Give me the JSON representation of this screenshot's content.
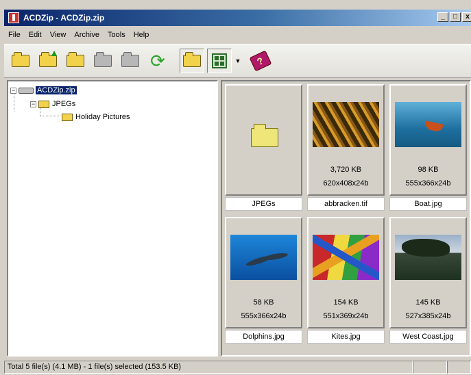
{
  "window": {
    "title": "ACDZip - ACDZip.zip"
  },
  "window_controls": {
    "minimize": "_",
    "maximize": "□",
    "close": "x"
  },
  "menu": [
    "File",
    "Edit",
    "View",
    "Archive",
    "Tools",
    "Help"
  ],
  "toolbar": {
    "buttons": [
      {
        "icon": "new-archive-icon"
      },
      {
        "icon": "open-archive-icon"
      },
      {
        "icon": "add-files-icon"
      },
      {
        "icon": "extract-icon"
      },
      {
        "icon": "view-icon"
      },
      {
        "icon": "convert-icon"
      },
      {
        "icon": "folder-tree-icon",
        "pressed": true
      },
      {
        "icon": "thumbnail-view-icon",
        "pressed": true
      },
      {
        "icon": "help-book-icon"
      }
    ]
  },
  "tree": {
    "items": [
      {
        "label": "ACDZip.zip",
        "selected": true,
        "icon": "drive-icon"
      },
      {
        "label": "JPEGs",
        "icon": "folder-icon"
      },
      {
        "label": "Holiday Pictures",
        "icon": "folder-icon"
      }
    ]
  },
  "thumbnails": [
    {
      "name": "JPEGs",
      "type": "folder",
      "size": "",
      "dims": ""
    },
    {
      "name": "abbracken.tif",
      "type": "image",
      "size": "3,720 KB",
      "dims": "620x408x24b"
    },
    {
      "name": "Boat.jpg",
      "type": "image",
      "size": "98 KB",
      "dims": "555x366x24b"
    },
    {
      "name": "Dolphins.jpg",
      "type": "image",
      "size": "58 KB",
      "dims": "555x366x24b"
    },
    {
      "name": "Kites.jpg",
      "type": "image",
      "size": "154 KB",
      "dims": "551x369x24b"
    },
    {
      "name": "West Coast.jpg",
      "type": "image",
      "size": "145 KB",
      "dims": "527x385x24b"
    }
  ],
  "status": {
    "text": "Total 5 file(s) (4.1 MB) - 1 file(s) selected (153.5 KB)"
  },
  "colors": {
    "title_active": "#0a246a",
    "face": "#d4d0c8",
    "selection": "#0a246a"
  }
}
